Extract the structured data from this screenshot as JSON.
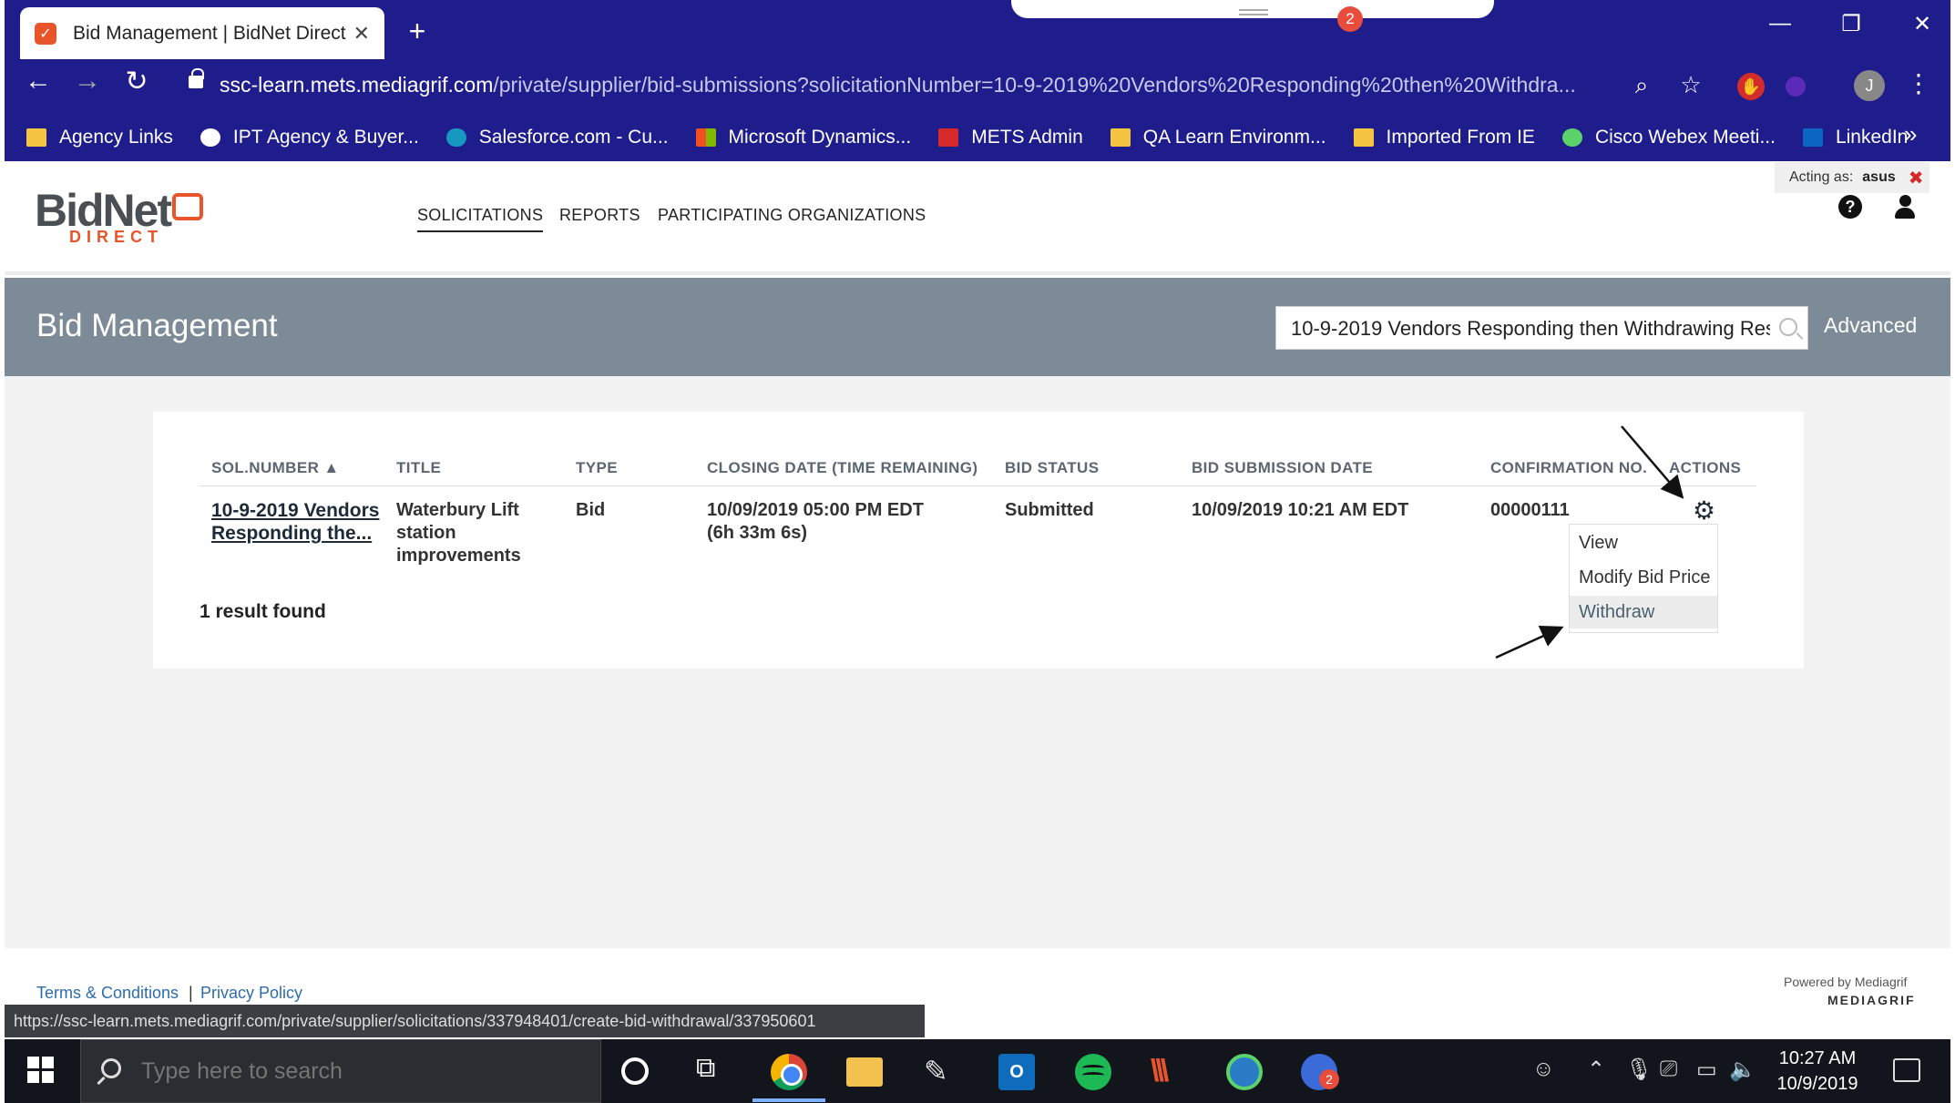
{
  "browser": {
    "tab_title": "Bid Management | BidNet Direct",
    "tab_favicon_icon": "bidnet-favicon-icon",
    "notification_count": "2",
    "url_host": "ssc-learn.mets.mediagrif.com",
    "url_path": "/private/supplier/bid-submissions?solicitationNumber=10-9-2019%20Vendors%20Responding%20then%20Withdra...",
    "profile_initial": "J",
    "bookmarks": [
      {
        "label": "Agency Links",
        "color": "#f5c542"
      },
      {
        "label": "IPT Agency & Buyer...",
        "color": "#ffffff"
      },
      {
        "label": "Salesforce.com - Cu...",
        "color": "#1798c1"
      },
      {
        "label": "Microsoft Dynamics...",
        "color": "#f25022"
      },
      {
        "label": "METS Admin",
        "color": "#d62a2a"
      },
      {
        "label": "QA Learn Environm...",
        "color": "#f5c542"
      },
      {
        "label": "Imported From IE",
        "color": "#f5c542"
      },
      {
        "label": "Cisco Webex Meeti...",
        "color": "#5bd36a"
      },
      {
        "label": "LinkedIn",
        "color": "#0a66c2"
      }
    ],
    "bookmark_overflow": "»"
  },
  "app": {
    "logo_main": "BidNet",
    "logo_sub": "DIRECT",
    "nav": {
      "solicitations": "SOLICITATIONS",
      "reports": "REPORTS",
      "organizations": "PARTICIPATING ORGANIZATIONS"
    },
    "acting_as_label": "Acting as:",
    "acting_as_user": "asus",
    "page_title": "Bid Management",
    "search_value": "10-9-2019 Vendors Responding then Withdrawing Res|",
    "advanced_label": "Advanced",
    "brand_color": "#e8552b",
    "band_color": "#7c8b97"
  },
  "table": {
    "headers": {
      "sol_number": "SOL.NUMBER",
      "title": "TITLE",
      "type": "TYPE",
      "closing": "CLOSING DATE (TIME REMAINING)",
      "status": "BID STATUS",
      "submission": "BID SUBMISSION DATE",
      "confirmation": "CONFIRMATION NO.",
      "actions": "ACTIONS"
    },
    "sort_indicator": "▲",
    "rows": [
      {
        "sol_number": "10-9-2019 Vendors Responding the...",
        "title": "Waterbury Lift station improvements",
        "type": "Bid",
        "closing_date": "10/09/2019 05:00 PM EDT",
        "time_remaining": "(6h 33m 6s)",
        "status": "Submitted",
        "submission_date": "10/09/2019 10:21 AM EDT",
        "confirmation": "00000111"
      }
    ],
    "result_count": "1 result found",
    "actions_menu": [
      "View",
      "Modify Bid Price",
      "Withdraw"
    ]
  },
  "footer": {
    "terms": "Terms & Conditions",
    "separator": "|",
    "privacy": "Privacy Policy",
    "powered_by": "Powered by Mediagrif",
    "mediagrif_logo": "MEDIAGRIF",
    "status_url": "https://ssc-learn.mets.mediagrif.com/private/supplier/solicitations/337948401/create-bid-withdrawal/337950601"
  },
  "taskbar": {
    "search_placeholder": "Type here to search",
    "teams_badge": "2",
    "time": "10:27 AM",
    "date": "10/9/2019"
  }
}
